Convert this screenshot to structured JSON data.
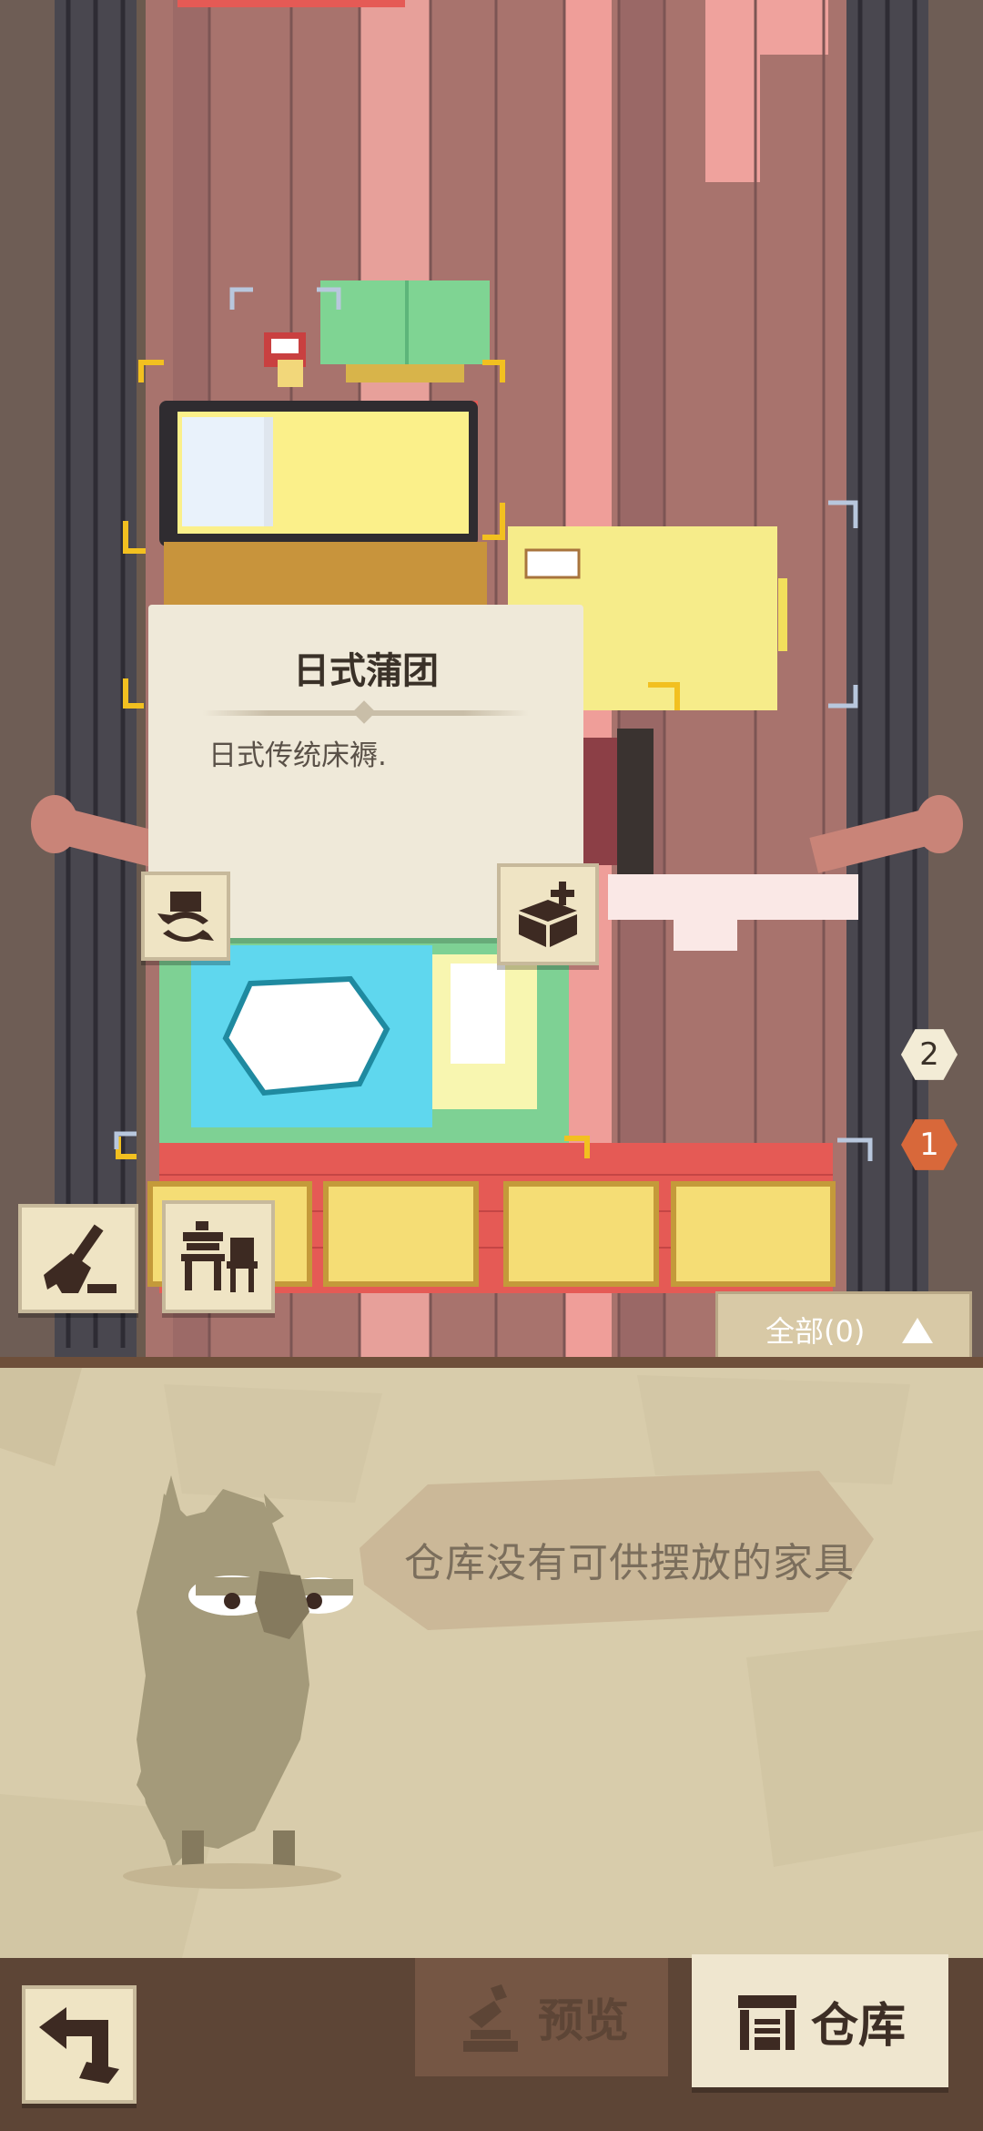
{
  "tooltip": {
    "title": "日式蒲团",
    "description": "日式传统床褥."
  },
  "floor_badges": [
    {
      "value": "2",
      "state": "inactive",
      "color": "#f3ecd6",
      "text_color": "#3a3128"
    },
    {
      "value": "1",
      "state": "active",
      "color": "#d8683a",
      "text_color": "#ffffff"
    }
  ],
  "filter": {
    "label": "全部(0)",
    "arrow": "caret-up-icon"
  },
  "storage_panel": {
    "empty_message": "仓库没有可供摆放的家具"
  },
  "bottom_nav": {
    "back_icon": "back-arrow-icon",
    "preview_label": "预览",
    "preview_icon": "preview-pedestal-icon",
    "storage_label": "仓库",
    "storage_icon": "warehouse-icon"
  },
  "toolbar": {
    "clean_icon": "broom-icon",
    "furniture_icon": "table-chair-icon",
    "rotate_icon": "rotate-box-icon",
    "store_icon": "box-plus-icon"
  },
  "colors": {
    "floor": "#a8736d",
    "wall": "#47444e",
    "grid_red": "#e55a55",
    "panel_bg": "#d8ccab",
    "bottom_bar": "#5d4536",
    "accent_orange": "#d8683a"
  }
}
